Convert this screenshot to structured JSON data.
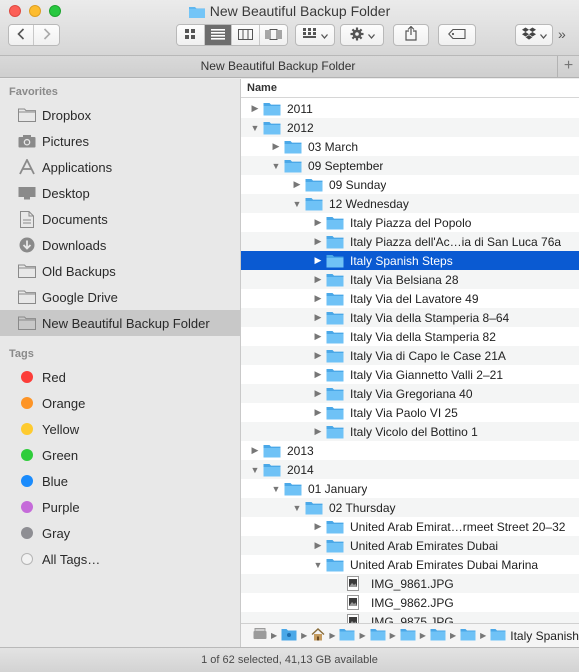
{
  "window": {
    "title": "New Beautiful Backup Folder"
  },
  "toolbar": {
    "back_icon": "chevron-left",
    "forward_icon": "chevron-right",
    "views": [
      "icon-view",
      "list-view",
      "column-view",
      "cover-flow-view"
    ],
    "active_view": "list-view",
    "arrange_icon": "grid-arrange",
    "action_icon": "gear",
    "share_icon": "share",
    "tag_icon": "tag",
    "dropbox_icon": "dropbox",
    "overflow": "»"
  },
  "tabbar": {
    "tab_label": "New Beautiful Backup Folder",
    "add_tab": "+"
  },
  "sidebar": {
    "favorites_heading": "Favorites",
    "favorites": [
      {
        "label": "Dropbox",
        "icon": "folder"
      },
      {
        "label": "Pictures",
        "icon": "camera"
      },
      {
        "label": "Applications",
        "icon": "applications"
      },
      {
        "label": "Desktop",
        "icon": "desktop"
      },
      {
        "label": "Documents",
        "icon": "document"
      },
      {
        "label": "Downloads",
        "icon": "download"
      },
      {
        "label": "Old Backups",
        "icon": "folder"
      },
      {
        "label": "Google Drive",
        "icon": "folder"
      },
      {
        "label": "New Beautiful Backup Folder",
        "icon": "folder"
      }
    ],
    "tags_heading": "Tags",
    "tags": [
      {
        "label": "Red",
        "color": "#fc3d39"
      },
      {
        "label": "Orange",
        "color": "#fd9426"
      },
      {
        "label": "Yellow",
        "color": "#fecb2f"
      },
      {
        "label": "Green",
        "color": "#2fcd3b"
      },
      {
        "label": "Blue",
        "color": "#1a8bfc"
      },
      {
        "label": "Purple",
        "color": "#c56bd9"
      },
      {
        "label": "Gray",
        "color": "#8e8e93"
      },
      {
        "label": "All Tags…",
        "color": "#e0e0e0"
      }
    ]
  },
  "list": {
    "column_name": "Name",
    "rows": [
      {
        "label": "2011",
        "depth": 0,
        "expanded": false,
        "type": "folder"
      },
      {
        "label": "2012",
        "depth": 0,
        "expanded": true,
        "type": "folder"
      },
      {
        "label": "03 March",
        "depth": 1,
        "expanded": false,
        "type": "folder"
      },
      {
        "label": "09 September",
        "depth": 1,
        "expanded": true,
        "type": "folder"
      },
      {
        "label": "09 Sunday",
        "depth": 2,
        "expanded": false,
        "type": "folder"
      },
      {
        "label": "12 Wednesday",
        "depth": 2,
        "expanded": true,
        "type": "folder"
      },
      {
        "label": "Italy Piazza del Popolo",
        "depth": 3,
        "expanded": false,
        "type": "folder"
      },
      {
        "label": "Italy Piazza dell'Ac…ia di San Luca 76a",
        "depth": 3,
        "expanded": false,
        "type": "folder"
      },
      {
        "label": "Italy Spanish Steps",
        "depth": 3,
        "expanded": false,
        "type": "folder",
        "selected": true
      },
      {
        "label": "Italy Via Belsiana 28",
        "depth": 3,
        "expanded": false,
        "type": "folder"
      },
      {
        "label": "Italy Via del Lavatore 49",
        "depth": 3,
        "expanded": false,
        "type": "folder"
      },
      {
        "label": "Italy Via della Stamperia 8–64",
        "depth": 3,
        "expanded": false,
        "type": "folder"
      },
      {
        "label": "Italy Via della Stamperia 82",
        "depth": 3,
        "expanded": false,
        "type": "folder"
      },
      {
        "label": "Italy Via di Capo le Case 21A",
        "depth": 3,
        "expanded": false,
        "type": "folder"
      },
      {
        "label": "Italy Via Giannetto Valli 2–21",
        "depth": 3,
        "expanded": false,
        "type": "folder"
      },
      {
        "label": "Italy Via Gregoriana 40",
        "depth": 3,
        "expanded": false,
        "type": "folder"
      },
      {
        "label": "Italy Via Paolo VI 25",
        "depth": 3,
        "expanded": false,
        "type": "folder"
      },
      {
        "label": "Italy Vicolo del Bottino 1",
        "depth": 3,
        "expanded": false,
        "type": "folder"
      },
      {
        "label": "2013",
        "depth": 0,
        "expanded": false,
        "type": "folder"
      },
      {
        "label": "2014",
        "depth": 0,
        "expanded": true,
        "type": "folder"
      },
      {
        "label": "01 January",
        "depth": 1,
        "expanded": true,
        "type": "folder"
      },
      {
        "label": "02 Thursday",
        "depth": 2,
        "expanded": true,
        "type": "folder"
      },
      {
        "label": "United Arab Emirat…rmeet Street 20–32",
        "depth": 3,
        "expanded": false,
        "type": "folder"
      },
      {
        "label": "United Arab Emirates Dubai",
        "depth": 3,
        "expanded": false,
        "type": "folder"
      },
      {
        "label": "United Arab Emirates Dubai Marina",
        "depth": 3,
        "expanded": true,
        "type": "folder"
      },
      {
        "label": "IMG_9861.JPG",
        "depth": 4,
        "expanded": null,
        "type": "image"
      },
      {
        "label": "IMG_9862.JPG",
        "depth": 4,
        "expanded": null,
        "type": "image"
      },
      {
        "label": "IMG_9875.JPG",
        "depth": 4,
        "expanded": null,
        "type": "image"
      }
    ]
  },
  "pathbar": {
    "items": [
      "disk-icon",
      "user-folder-icon",
      "home-icon",
      "folder-icon",
      "folder-icon",
      "folder-icon",
      "folder-icon",
      "folder-icon",
      "folder-icon"
    ],
    "last_label": "Italy Spanish Steps"
  },
  "status": {
    "text": "1 of 62 selected, 41,13 GB available"
  }
}
